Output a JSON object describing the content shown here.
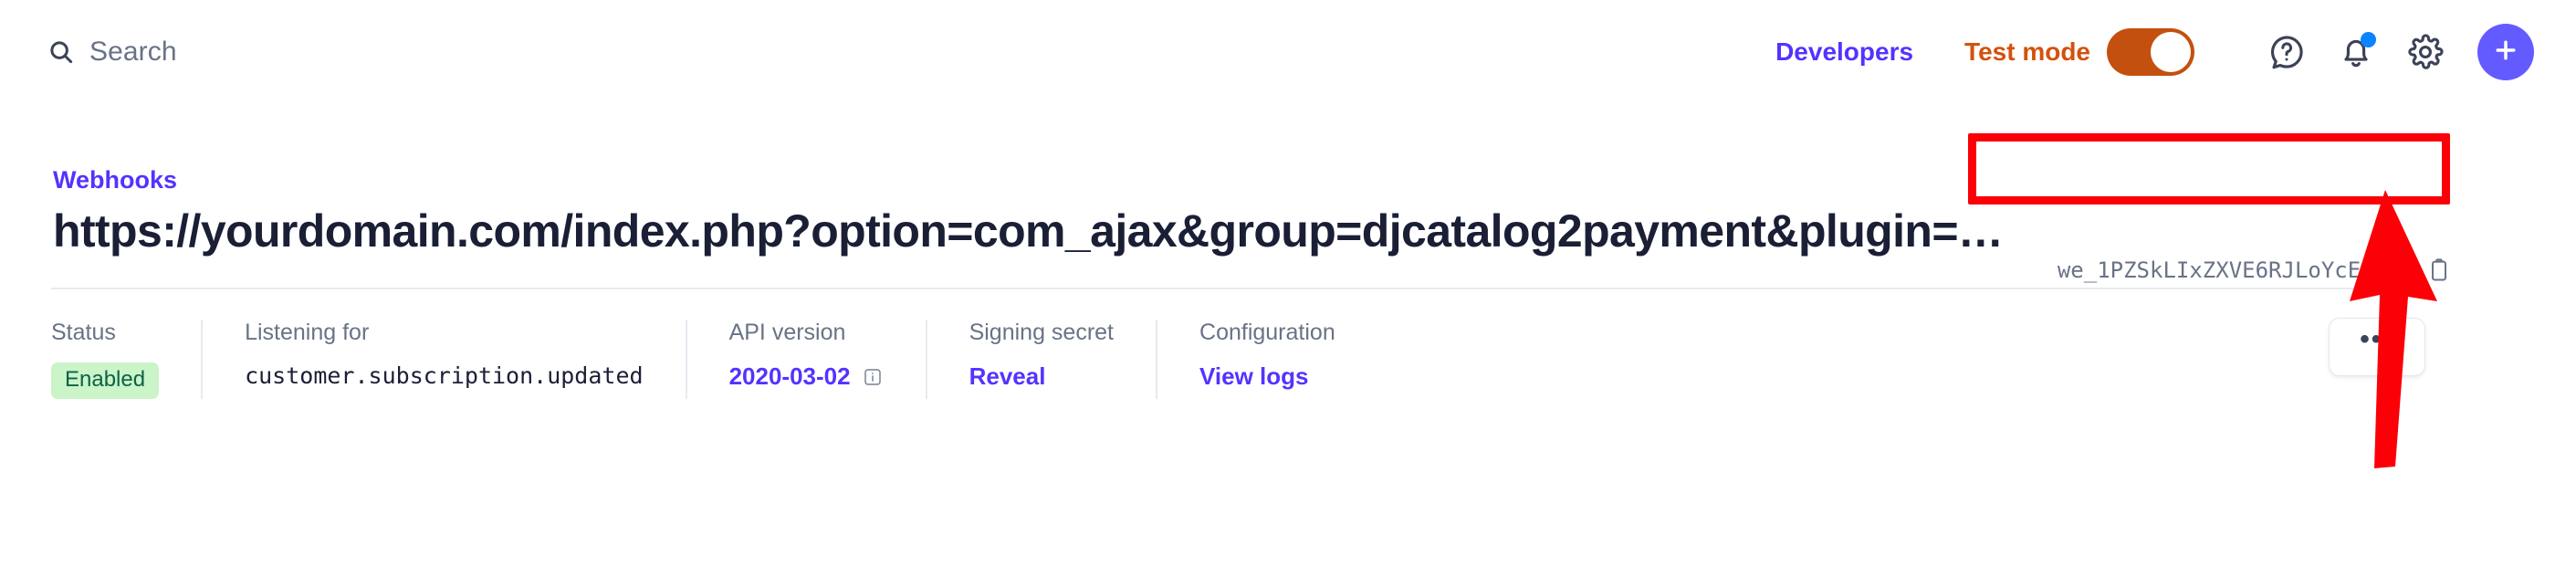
{
  "topbar": {
    "search": {
      "icon": "search-icon",
      "placeholder": "Search"
    },
    "developers_label": "Developers",
    "test_mode": {
      "label": "Test mode",
      "enabled": true,
      "color": "#d4510d",
      "toggle_color": "#c4500f"
    },
    "icons": [
      {
        "name": "help-icon",
        "label": "Help"
      },
      {
        "name": "notifications-bell-icon",
        "label": "Notifications",
        "has_dot": true,
        "dot_color": "#0a84ff"
      },
      {
        "name": "settings-gear-icon",
        "label": "Settings"
      },
      {
        "name": "add-plus-icon",
        "label": "Create",
        "color": "#635bff"
      }
    ]
  },
  "page": {
    "breadcrumb": "Webhooks",
    "title": "https://yourdomain.com/index.php?option=com_ajax&group=djcatalog2payment&plugin=…",
    "webhook_id": "we_1PZSkLIxZXVE6RJLoYcE3UyW",
    "copy_icon": "clipboard-copy-icon",
    "more_actions_label": "•••"
  },
  "meta": {
    "columns": [
      {
        "label": "Status",
        "value": "Enabled",
        "type": "badge",
        "badge_bg": "#cbf4c9",
        "badge_fg": "#0e6245"
      },
      {
        "label": "Listening for",
        "value": "customer.subscription.updated",
        "type": "mono"
      },
      {
        "label": "API version",
        "value": "2020-03-02",
        "type": "link",
        "has_info_icon": true
      },
      {
        "label": "Signing secret",
        "value": "Reveal",
        "type": "link"
      },
      {
        "label": "Configuration",
        "value": "View logs",
        "type": "link"
      }
    ]
  },
  "annotation": {
    "highlight_color": "#fb0007",
    "shapes": [
      "rectangle-around-webhook-id",
      "arrow-pointing-to-copy-icon"
    ]
  },
  "colors": {
    "brand_purple": "#635bff",
    "link_purple": "#5433ff",
    "text_dark": "#1a1f36",
    "text_muted": "#697386",
    "divider": "#e6ebf1"
  }
}
